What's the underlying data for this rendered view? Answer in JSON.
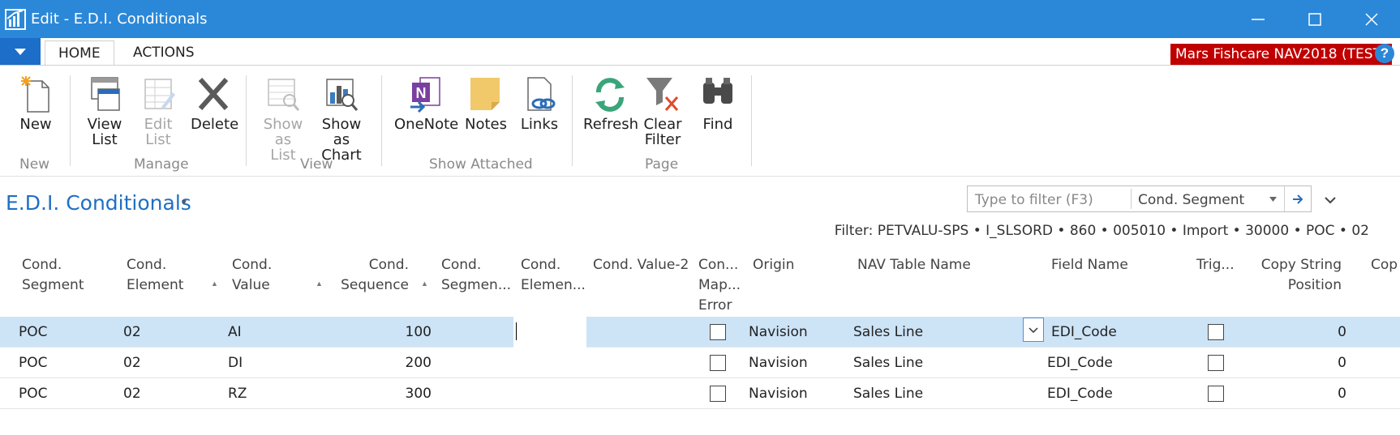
{
  "window": {
    "title": "Edit - E.D.I. Conditionals"
  },
  "tabs": {
    "home": "HOME",
    "actions": "ACTIONS"
  },
  "company": "Mars Fishcare NAV2018 (TEST)",
  "help": "?",
  "ribbon": {
    "new": "New",
    "view_list_1": "View",
    "view_list_2": "List",
    "edit_list_1": "Edit",
    "edit_list_2": "List",
    "delete": "Delete",
    "show_as_list_1": "Show",
    "show_as_list_2": "as List",
    "show_as_chart_1": "Show as",
    "show_as_chart_2": "Chart",
    "onenote": "OneNote",
    "notes": "Notes",
    "links": "Links",
    "refresh": "Refresh",
    "clear_filter_1": "Clear",
    "clear_filter_2": "Filter",
    "find": "Find",
    "groups": {
      "new": "New",
      "manage": "Manage",
      "view": "View",
      "show_attached": "Show Attached",
      "page": "Page"
    }
  },
  "page": {
    "title": "E.D.I. Conditionals",
    "filter_placeholder": "Type to filter (F3)",
    "filter_field": "Cond. Segment",
    "filter_text": "Filter: PETVALU-SPS • I_SLSORD • 860 • 005010 • Import • 30000 • POC • 02"
  },
  "columns": {
    "cond_segment_1": "Cond.",
    "cond_segment_2": "Segment",
    "cond_element_1": "Cond.",
    "cond_element_2": "Element",
    "cond_value_1": "Cond.",
    "cond_value_2": "Value",
    "cond_sequence_1": "Cond.",
    "cond_sequence_2": "Sequence",
    "cond_segment2_1": "Cond.",
    "cond_segment2_2": "Segmen...",
    "cond_element2_1": "Cond.",
    "cond_element2_2": "Elemen...",
    "cond_value2": "Cond. Value-2",
    "con_map_1": "Con...",
    "con_map_2": "Map...",
    "con_map_3": "Error",
    "origin": "Origin",
    "nav_table": "NAV Table Name",
    "field_name": "Field Name",
    "trig": "Trig...",
    "copy_string_1": "Copy String",
    "copy_string_2": "Position",
    "cop_cut": "Cop"
  },
  "rows": [
    {
      "segment": "POC",
      "element": "02",
      "value": "AI",
      "sequence": "100",
      "origin": "Navision",
      "table": "Sales Line",
      "field": "EDI_Code",
      "copy_pos": "0",
      "map_error": false,
      "trig": false
    },
    {
      "segment": "POC",
      "element": "02",
      "value": "DI",
      "sequence": "200",
      "origin": "Navision",
      "table": "Sales Line",
      "field": "EDI_Code",
      "copy_pos": "0",
      "map_error": false,
      "trig": false
    },
    {
      "segment": "POC",
      "element": "02",
      "value": "RZ",
      "sequence": "300",
      "origin": "Navision",
      "table": "Sales Line",
      "field": "EDI_Code",
      "copy_pos": "0",
      "map_error": false,
      "trig": false
    }
  ]
}
